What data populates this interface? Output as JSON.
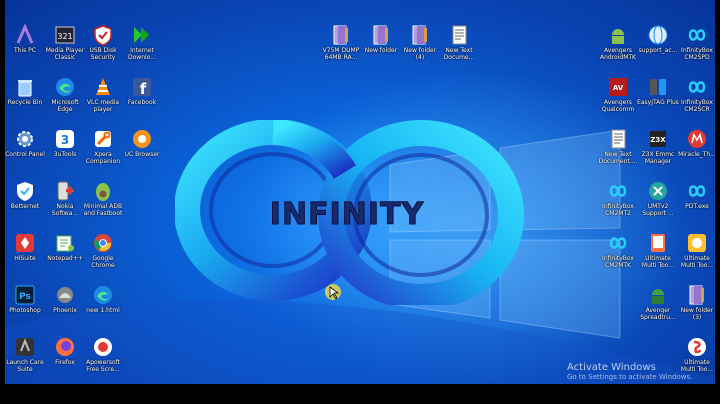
{
  "desktop": {
    "logo_text": "INFINITY",
    "watermark": {
      "title": "Activate Windows",
      "subtitle": "Go to Settings to activate Windows."
    },
    "colors": {
      "accent": "#0a62d8",
      "logo_ring": "#22c4f0",
      "logo_ring_dark": "#1a3fd0"
    }
  },
  "icons": [
    {
      "id": "thispc",
      "label": "This PC",
      "glyph": "arch-icon"
    },
    {
      "id": "mpc",
      "label": "Media Player Classic",
      "glyph": "media-player-icon"
    },
    {
      "id": "usb",
      "label": "USB Disk Security",
      "glyph": "shield-icon"
    },
    {
      "id": "idm",
      "label": "Internet Downlo...",
      "glyph": "download-arrows-icon"
    },
    {
      "id": "recycle",
      "label": "Recycle Bin",
      "glyph": "recycle-bin-icon"
    },
    {
      "id": "edge",
      "label": "Microsoft Edge",
      "glyph": "edge-icon"
    },
    {
      "id": "vlc",
      "label": "VLC media player",
      "glyph": "vlc-cone-icon"
    },
    {
      "id": "fb",
      "label": "Facebook",
      "glyph": "facebook-icon"
    },
    {
      "id": "cp",
      "label": "Control Panel",
      "glyph": "gear-icon"
    },
    {
      "id": "3u",
      "label": "3uTools",
      "glyph": "3u-icon"
    },
    {
      "id": "xpera",
      "label": "Xpera Companion",
      "glyph": "wrench-icon"
    },
    {
      "id": "uc",
      "label": "UC Browser",
      "glyph": "squirrel-icon"
    },
    {
      "id": "better",
      "label": "Betternet",
      "glyph": "shield-check-icon"
    },
    {
      "id": "nokia",
      "label": "Nokia Softwa...",
      "glyph": "phone-plus-icon"
    },
    {
      "id": "adb",
      "label": "Minimal ADB and Fastboot",
      "glyph": "avocado-icon"
    },
    {
      "id": "hisuite",
      "label": "HiSuite",
      "glyph": "hisuite-icon"
    },
    {
      "id": "npp",
      "label": "Notepad++",
      "glyph": "notepad-icon"
    },
    {
      "id": "chrome",
      "label": "Google Chrome",
      "glyph": "chrome-icon"
    },
    {
      "id": "ps",
      "label": "Photoshop",
      "glyph": "photoshop-icon"
    },
    {
      "id": "phoenix",
      "label": "Phoenix",
      "glyph": "bird-icon"
    },
    {
      "id": "newhtml",
      "label": "new 1.html",
      "glyph": "edge-html-icon"
    },
    {
      "id": "launch",
      "label": "Launch Care Suite",
      "glyph": "launch-icon"
    },
    {
      "id": "firefox",
      "label": "Firefox",
      "glyph": "firefox-icon"
    },
    {
      "id": "apower",
      "label": "Apowersoft Free Scre...",
      "glyph": "record-icon"
    },
    {
      "id": "v75m",
      "label": "V75M DUMP 64MB RA...",
      "glyph": "folder-icon"
    },
    {
      "id": "nf1",
      "label": "New folder",
      "glyph": "folder-icon"
    },
    {
      "id": "nf4",
      "label": "New folder (4)",
      "glyph": "folder-icon"
    },
    {
      "id": "ntd1",
      "label": "New Text Docume...",
      "glyph": "text-doc-icon"
    },
    {
      "id": "avamtk",
      "label": "Avengers AndroidMTK",
      "glyph": "android-icon"
    },
    {
      "id": "supac",
      "label": "support_ac...",
      "glyph": "globe-icon"
    },
    {
      "id": "ibcm2sd",
      "label": "InfinityBox CM2SPD",
      "glyph": "infinity-icon"
    },
    {
      "id": "avqual",
      "label": "Avengers Qualcomm",
      "glyph": "avengers-icon"
    },
    {
      "id": "easyjtag",
      "label": "EasyJTAG Plus",
      "glyph": "phones-icon"
    },
    {
      "id": "ibcm2scr",
      "label": "InfinityBox CM2SCR",
      "glyph": "infinity-icon"
    },
    {
      "id": "ntd2",
      "label": "New Text Document....",
      "glyph": "text-doc-icon"
    },
    {
      "id": "z3x",
      "label": "Z3X Emmc Manager",
      "glyph": "chip-icon"
    },
    {
      "id": "miracle",
      "label": "Miracle_Th...",
      "glyph": "miracle-icon"
    },
    {
      "id": "ibcm2mt2",
      "label": "InfinityBox CM2MT2",
      "glyph": "infinity-icon"
    },
    {
      "id": "umt",
      "label": "UMTv2 Support ...",
      "glyph": "umt-icon"
    },
    {
      "id": "pdt",
      "label": "PDT.exe",
      "glyph": "infinity-icon"
    },
    {
      "id": "ibcm2mtk",
      "label": "InfinityBox CM2MTK",
      "glyph": "infinity-icon"
    },
    {
      "id": "ultimate1",
      "label": "Ultimate Multi Too...",
      "glyph": "ultimate-icon"
    },
    {
      "id": "ultimate2",
      "label": "Ultimate Multi Too...",
      "glyph": "ultimate-gold-icon"
    },
    {
      "id": "avspread",
      "label": "Avenger Spreadtru...",
      "glyph": "avenger-android-icon"
    },
    {
      "id": "nf3",
      "label": "New folder (3)",
      "glyph": "folder-icon"
    },
    {
      "id": "ultimate3",
      "label": "Ultimate Multi Too...",
      "glyph": "snapdragon-icon"
    }
  ]
}
